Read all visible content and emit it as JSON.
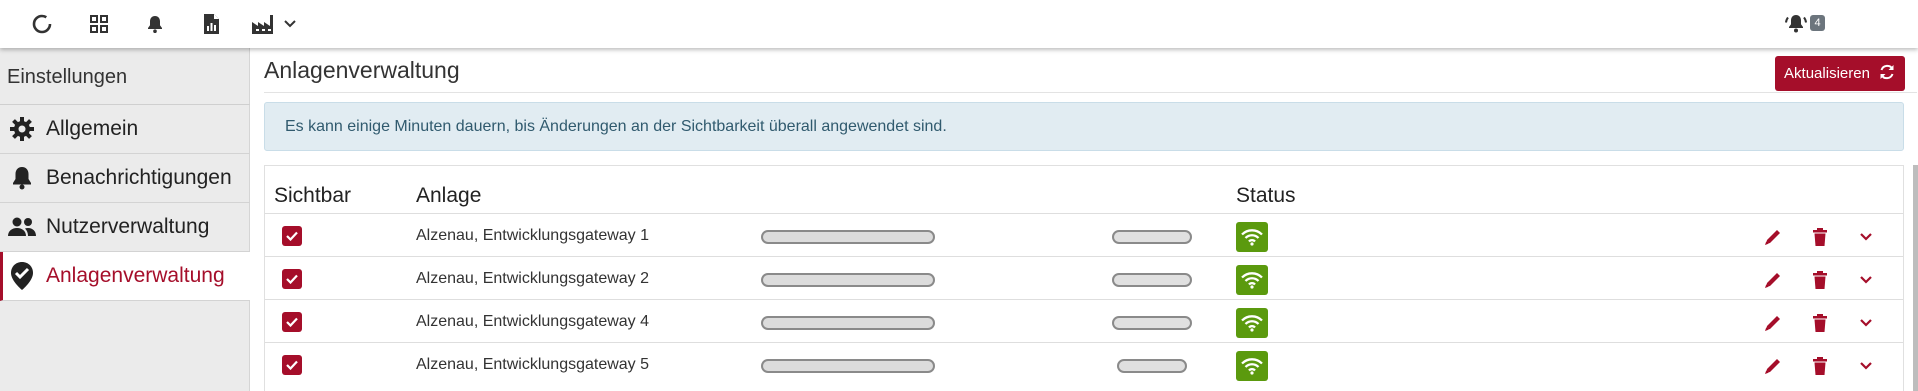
{
  "topbar": {
    "icons": [
      "loading-ring-icon",
      "grid-icon",
      "bell-icon",
      "file-chart-icon",
      "factory-icon",
      "chevron-down-icon"
    ],
    "alarm_icon": "bell-alarm-icon",
    "alarm_count": "4"
  },
  "sidebar": {
    "title": "Einstellungen",
    "items": [
      {
        "label": "Allgemein",
        "icon": "gear-icon"
      },
      {
        "label": "Benachrichtigungen",
        "icon": "bell-icon"
      },
      {
        "label": "Nutzerverwaltung",
        "icon": "users-icon"
      },
      {
        "label": "Anlagenverwaltung",
        "icon": "map-marker-check-icon",
        "active": true
      }
    ]
  },
  "main": {
    "title": "Anlagenverwaltung",
    "refresh_label": "Aktualisieren",
    "info_text": "Es kann einige Minuten dauern, bis Änderungen an der Sichtbarkeit überall angewendet sind.",
    "table": {
      "headers": {
        "visible": "Sichtbar",
        "plant": "Anlage",
        "status": "Status"
      },
      "rows": [
        {
          "name": "Alzenau, Entwicklungsgateway 1",
          "visible": true,
          "status": "online"
        },
        {
          "name": "Alzenau, Entwicklungsgateway 2",
          "visible": true,
          "status": "online"
        },
        {
          "name": "Alzenau, Entwicklungsgateway 4",
          "visible": true,
          "status": "online"
        },
        {
          "name": "Alzenau, Entwicklungsgateway 5",
          "visible": true,
          "status": "online"
        }
      ]
    }
  },
  "colors": {
    "accent": "#a50e2a",
    "status_ok": "#5b9a0e",
    "info_bg": "#e1ecf2"
  }
}
